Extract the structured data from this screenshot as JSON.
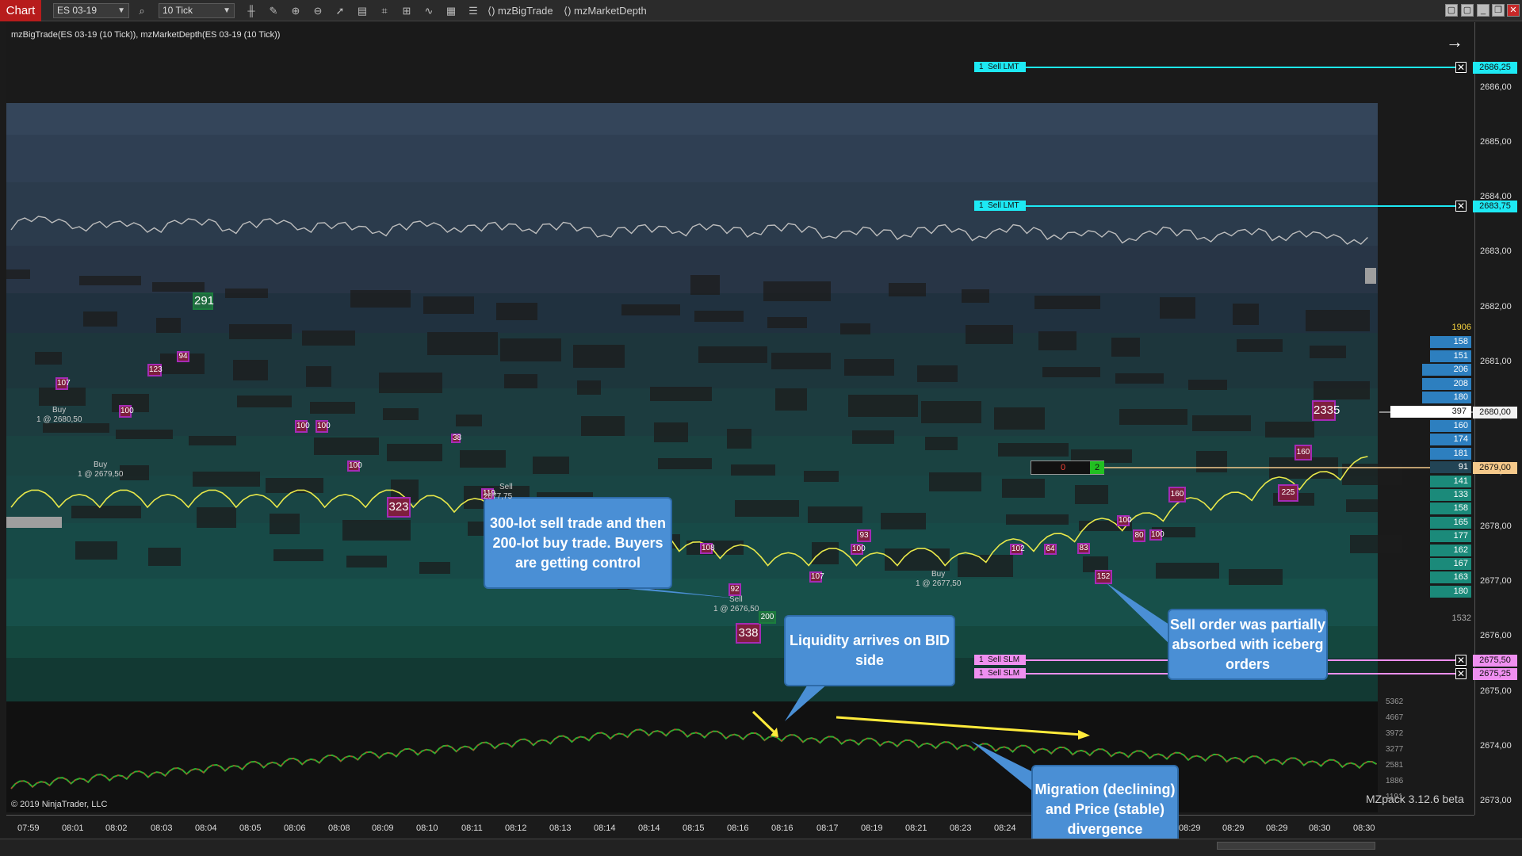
{
  "toolbar": {
    "tab": "Chart",
    "instrument": "ES 03-19",
    "interval": "10 Tick",
    "indicators": [
      "mzBigTrade",
      "mzMarketDepth"
    ]
  },
  "indicator_title": "mzBigTrade(ES 03-19 (10 Tick)), mzMarketDepth(ES 03-19 (10 Tick))",
  "price_axis": {
    "labels": [
      "2686,00",
      "2685,00",
      "2684,00",
      "2683,00",
      "2682,00",
      "2681,00",
      "2680,00",
      "2679,00",
      "2678,00",
      "2677,00",
      "2676,00",
      "2675,00",
      "2674,00",
      "2673,00"
    ],
    "tags": [
      {
        "text": "2686,25",
        "style": "cyan"
      },
      {
        "text": "2683,75",
        "style": "cyan"
      },
      {
        "text": "2680,00",
        "style": "white"
      },
      {
        "text": "2679,00",
        "style": "tan"
      },
      {
        "text": "2675,50",
        "style": "pink"
      },
      {
        "text": "2675,25",
        "style": "pink"
      }
    ]
  },
  "volume_axis": [
    "5362",
    "4667",
    "3972",
    "3277",
    "2581",
    "1886",
    "1191"
  ],
  "time_axis": [
    "07:59",
    "08:01",
    "08:02",
    "08:03",
    "08:04",
    "08:05",
    "08:06",
    "08:08",
    "08:09",
    "08:10",
    "08:11",
    "08:12",
    "08:13",
    "08:14",
    "08:14",
    "08:15",
    "08:16",
    "08:16",
    "08:17",
    "08:19",
    "08:21",
    "08:23",
    "08:24",
    "08:29",
    "08:29",
    "08:29",
    "08:30",
    "08:30"
  ],
  "depth": {
    "ask_total": "1906",
    "ask": [
      "158",
      "151",
      "206",
      "208",
      "180"
    ],
    "current": "397",
    "bid": [
      "160",
      "174",
      "181",
      "91",
      "141",
      "133",
      "158",
      "165",
      "177",
      "162",
      "167",
      "163",
      "180"
    ],
    "bid_total": "1532"
  },
  "orders": [
    {
      "qty": "1",
      "type": "Sell LMT"
    },
    {
      "qty": "1",
      "type": "Sell LMT"
    },
    {
      "qty": "1",
      "type": "Sell SLM"
    },
    {
      "qty": "1",
      "type": "Sell SLM"
    }
  ],
  "position": {
    "left": "0",
    "right": "2"
  },
  "big_trades": [
    {
      "v": "291"
    },
    {
      "v": "107"
    },
    {
      "v": "123"
    },
    {
      "v": "94"
    },
    {
      "v": "100"
    },
    {
      "v": "100"
    },
    {
      "v": "100"
    },
    {
      "v": "100"
    },
    {
      "v": "323"
    },
    {
      "v": "38"
    },
    {
      "v": "119"
    },
    {
      "v": "108"
    },
    {
      "v": "92"
    },
    {
      "v": "338"
    },
    {
      "v": "200"
    },
    {
      "v": "107"
    },
    {
      "v": "93"
    },
    {
      "v": "100"
    },
    {
      "v": "102"
    },
    {
      "v": "64"
    },
    {
      "v": "83"
    },
    {
      "v": "152"
    },
    {
      "v": "100"
    },
    {
      "v": "80"
    },
    {
      "v": "100"
    },
    {
      "v": "160"
    },
    {
      "v": "225"
    },
    {
      "v": "160"
    },
    {
      "v": "2335"
    }
  ],
  "trade_labels": [
    {
      "side": "Buy",
      "fill": "1 @ 2680,50"
    },
    {
      "side": "Buy",
      "fill": "1 @ 2679,50"
    },
    {
      "side": "Sell",
      "fill": "2677,75"
    },
    {
      "side": "Sell",
      "fill": "1 @ 2676,50"
    },
    {
      "side": "Buy",
      "fill": "1 @ 2677,50"
    }
  ],
  "callouts": {
    "c1": "300-lot sell trade and then 200-lot buy trade. Buyers are getting control",
    "c2": "Liquidity arrives on BID side",
    "c3": "Sell order was partially absorbed with iceberg orders",
    "c4": "Migration (declining) and Price (stable) divergence"
  },
  "copyright": "© 2019 NinjaTrader, LLC",
  "version": "MZpack 3.12.6 beta",
  "colors": {
    "bid": "#1b8a7a",
    "ask": "#2d7fbf",
    "price": "#e8e84a",
    "order_cyan": "#1de9f4",
    "order_pink": "#ef8ff0"
  }
}
